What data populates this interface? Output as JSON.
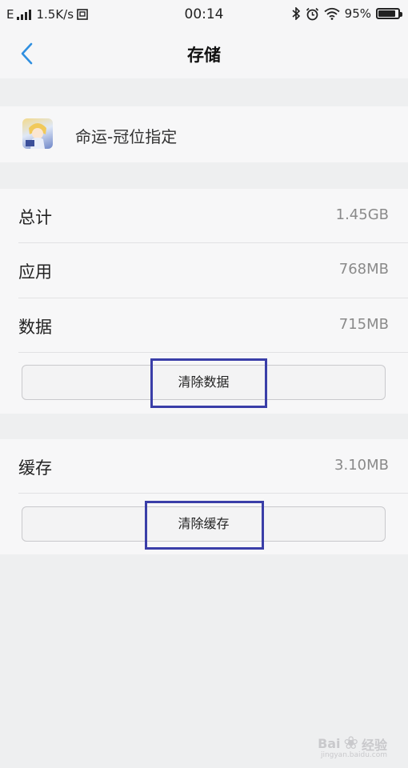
{
  "status_bar": {
    "network_type": "E",
    "speed": "1.5K/s",
    "time": "00:14",
    "battery_percent": "95%",
    "battery_level": 0.95
  },
  "nav": {
    "title": "存储"
  },
  "app": {
    "name": "命运-冠位指定"
  },
  "storage": {
    "total_label": "总计",
    "total_value": "1.45GB",
    "app_label": "应用",
    "app_value": "768MB",
    "data_label": "数据",
    "data_value": "715MB",
    "clear_data_button": "清除数据"
  },
  "cache": {
    "label": "缓存",
    "value": "3.10MB",
    "clear_cache_button": "清除缓存"
  },
  "watermark": {
    "text": "Bai",
    "text2": "经验",
    "sub": "jingyan.baidu.com"
  },
  "colors": {
    "accent": "#2f8fe0",
    "highlight": "#3a3ea8"
  }
}
